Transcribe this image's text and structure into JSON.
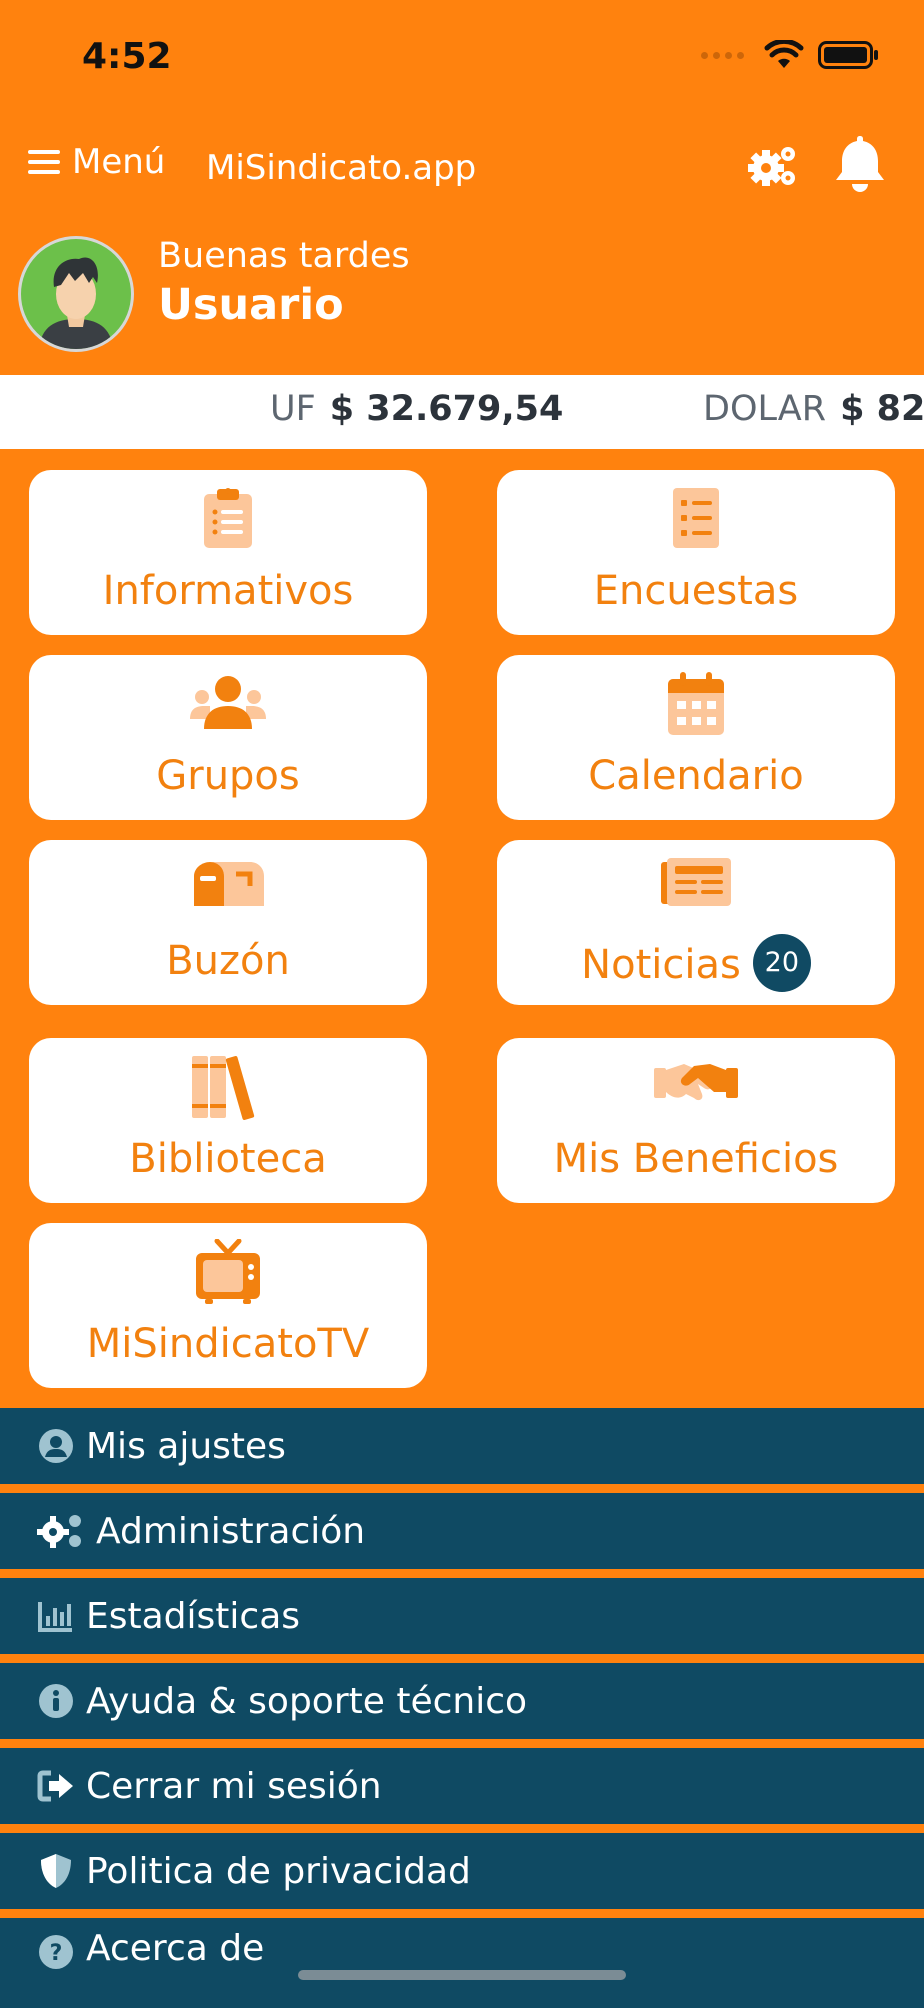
{
  "status_bar": {
    "time": "4:52"
  },
  "nav": {
    "menu_label": "Menú",
    "title": "MiSindicato.app"
  },
  "greeting": {
    "salutation": "Buenas tardes",
    "user_name": "Usuario"
  },
  "ticker": [
    {
      "label": "UF",
      "value": "$ 32.679,54"
    },
    {
      "label": "DOLAR",
      "value": "$ 82"
    }
  ],
  "tiles": [
    {
      "label": "Informativos",
      "icon": "clipboard-icon"
    },
    {
      "label": "Encuestas",
      "icon": "survey-list-icon"
    },
    {
      "label": "Grupos",
      "icon": "users-group-icon"
    },
    {
      "label": "Calendario",
      "icon": "calendar-icon"
    },
    {
      "label": "Buzón",
      "icon": "mailbox-icon"
    },
    {
      "label": "Noticias",
      "icon": "newspaper-icon",
      "badge": "20"
    },
    {
      "label": "Biblioteca",
      "icon": "books-icon"
    },
    {
      "label": "Mis Beneficios",
      "icon": "handshake-icon"
    },
    {
      "label": "MiSindicatoTV",
      "icon": "tv-icon"
    }
  ],
  "menu_items": [
    {
      "label": "Mis ajustes",
      "icon": "user-circle-icon"
    },
    {
      "label": "Administración",
      "icon": "gears-icon"
    },
    {
      "label": "Estadísticas",
      "icon": "bar-chart-icon"
    },
    {
      "label": "Ayuda & soporte técnico",
      "icon": "info-icon"
    },
    {
      "label": "Cerrar mi sesión",
      "icon": "sign-out-icon"
    },
    {
      "label": "Politica de privacidad",
      "icon": "shield-icon"
    },
    {
      "label": "Acerca de",
      "icon": "question-icon"
    }
  ],
  "colors": {
    "brand_orange": "#FF820E",
    "tile_text": "#F2810F",
    "menu_bg": "#0F4A63",
    "badge_bg": "#104A63",
    "icon_light": "#FCC69A"
  }
}
